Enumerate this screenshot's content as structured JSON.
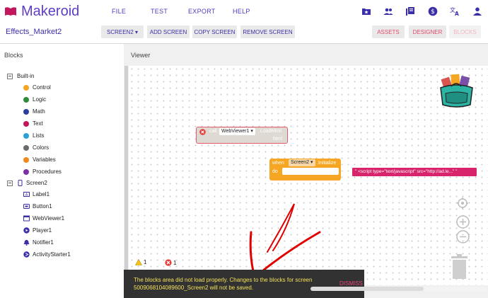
{
  "app": {
    "name": "Makeroid",
    "project_name": "Effects_Market2",
    "brand_color": "#5f3dc4"
  },
  "menu": [
    "FILE",
    "TEST",
    "EXPORT",
    "HELP"
  ],
  "toolbar_icons": [
    "gallery-star-icon",
    "people-icon",
    "library-icon",
    "dollar-icon",
    "translate-icon",
    "account-icon"
  ],
  "screen_bar": {
    "screen_select": "SCREEN2 ▾",
    "add_screen": "ADD SCREEN",
    "copy_screen": "COPY SCREEN",
    "remove_screen": "REMOVE SCREEN",
    "assets": "ASSETS",
    "designer": "DESIGNER",
    "blocks": "BLOCKS"
  },
  "blocks_panel": {
    "title": "Blocks",
    "builtin_label": "Built-in",
    "builtin": [
      {
        "label": "Control",
        "color": "#f5a623"
      },
      {
        "label": "Logic",
        "color": "#2e8b3a"
      },
      {
        "label": "Math",
        "color": "#2c3e9e"
      },
      {
        "label": "Text",
        "color": "#c2185b"
      },
      {
        "label": "Lists",
        "color": "#29a3d6"
      },
      {
        "label": "Colors",
        "color": "#6b6b6b"
      },
      {
        "label": "Variables",
        "color": "#f08a1c"
      },
      {
        "label": "Procedures",
        "color": "#7b2fa8"
      }
    ],
    "screen_label": "Screen2",
    "components": [
      {
        "label": "Label1",
        "icon": "label-icon"
      },
      {
        "label": "Button1",
        "icon": "button-icon"
      },
      {
        "label": "WebViewer1",
        "icon": "webviewer-icon"
      },
      {
        "label": "Player1",
        "icon": "player-icon"
      },
      {
        "label": "Notifier1",
        "icon": "notifier-icon"
      },
      {
        "label": "ActivityStarter1",
        "icon": "activity-icon"
      }
    ]
  },
  "viewer": {
    "title": "Viewer",
    "call_block": {
      "keyword": "call",
      "component": "WebViewer1 ▾",
      "method": ".LoadHtml",
      "arg": "html"
    },
    "event_block": {
      "when": "when",
      "component": "Screen2 ▾",
      "event": ".Initialize",
      "do": "do"
    },
    "text_block": "\" <script type=\"text/javascript\" src=\"http://ad.le...\" \"",
    "warnings_count": "1",
    "errors_count": "1"
  },
  "toast": {
    "message": "The blocks area did not load properly. Changes to the blocks for screen 5009068104089600_Screen2 will not be saved.",
    "dismiss": "DISMISS"
  }
}
